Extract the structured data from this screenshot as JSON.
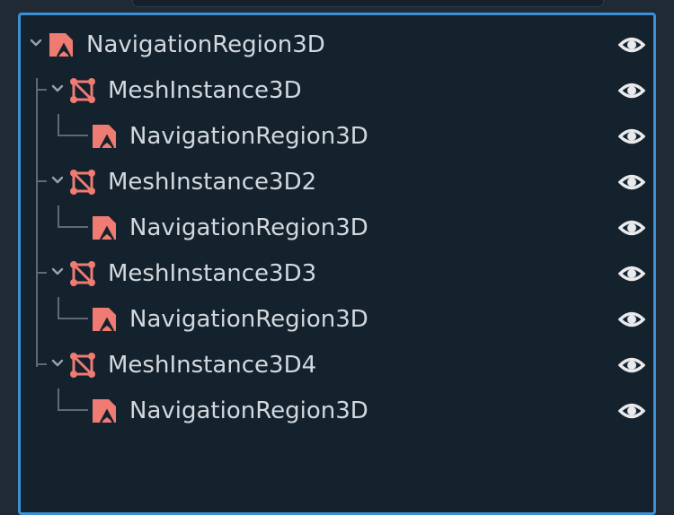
{
  "tree": {
    "nodes": [
      {
        "label": "NavigationRegion3D",
        "type": "NavigationRegion3D",
        "icon": "navigation-region-icon",
        "depth": 0,
        "expanded": true,
        "visible": true
      },
      {
        "label": "MeshInstance3D",
        "type": "MeshInstance3D",
        "icon": "mesh-instance-icon",
        "depth": 1,
        "expanded": true,
        "visible": true
      },
      {
        "label": "NavigationRegion3D",
        "type": "NavigationRegion3D",
        "icon": "navigation-region-icon",
        "depth": 2,
        "expanded": false,
        "visible": true
      },
      {
        "label": "MeshInstance3D2",
        "type": "MeshInstance3D",
        "icon": "mesh-instance-icon",
        "depth": 1,
        "expanded": true,
        "visible": true
      },
      {
        "label": "NavigationRegion3D",
        "type": "NavigationRegion3D",
        "icon": "navigation-region-icon",
        "depth": 2,
        "expanded": false,
        "visible": true
      },
      {
        "label": "MeshInstance3D3",
        "type": "MeshInstance3D",
        "icon": "mesh-instance-icon",
        "depth": 1,
        "expanded": true,
        "visible": true
      },
      {
        "label": "NavigationRegion3D",
        "type": "NavigationRegion3D",
        "icon": "navigation-region-icon",
        "depth": 2,
        "expanded": false,
        "visible": true
      },
      {
        "label": "MeshInstance3D4",
        "type": "MeshInstance3D",
        "icon": "mesh-instance-icon",
        "depth": 1,
        "expanded": true,
        "visible": true
      },
      {
        "label": "NavigationRegion3D",
        "type": "NavigationRegion3D",
        "icon": "navigation-region-icon",
        "depth": 2,
        "expanded": false,
        "visible": true
      }
    ]
  },
  "colors": {
    "panel_background": "#13222c",
    "panel_border": "#3d8fd6",
    "node_icon": "#f07b73",
    "text": "#d3d8de",
    "eye_icon": "#e8eaed",
    "guide_lines": "#5f6a73"
  }
}
